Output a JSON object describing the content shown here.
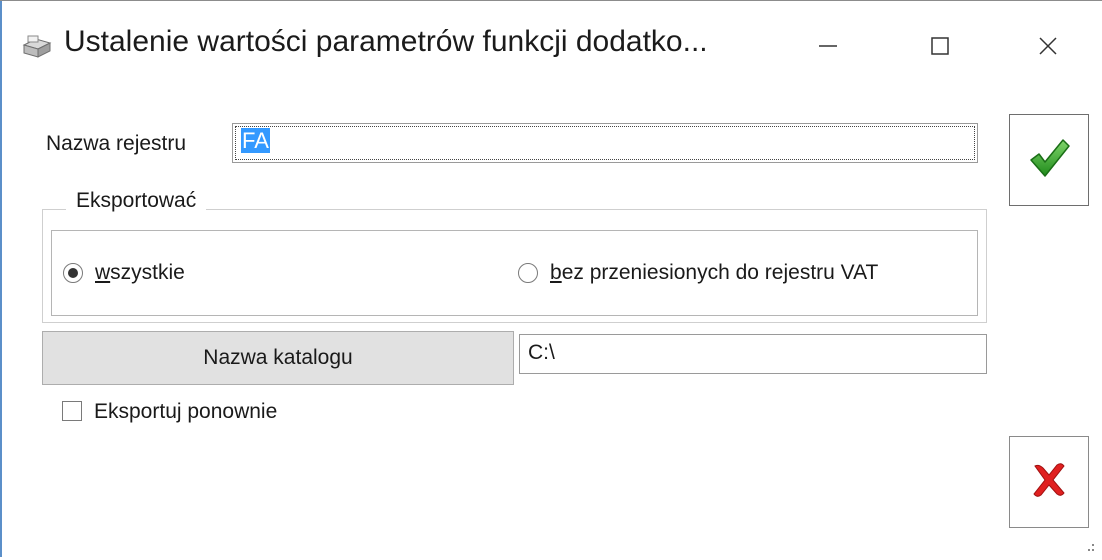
{
  "window": {
    "title": "Ustalenie wartości parametrów funkcji dodatko...",
    "minimize_glyph": "—",
    "maximize_glyph": "☐",
    "close_glyph": "✕"
  },
  "form": {
    "nazwa_rejestru_label": "Nazwa rejestru",
    "nazwa_rejestru_value": "FA",
    "eksportowac": {
      "title": "Eksportować",
      "options": [
        {
          "mnemonic": "w",
          "rest": "szystkie",
          "checked": true
        },
        {
          "mnemonic": "b",
          "rest": "ez przeniesionych do rejestru VAT",
          "checked": false
        }
      ]
    },
    "nazwa_katalogu_button": "Nazwa katalogu",
    "nazwa_katalogu_value": "C:\\",
    "eksportuj_ponownie_label": "Eksportuj ponownie",
    "eksportuj_ponownie_checked": false
  },
  "buttons": {
    "ok_icon": "green-checkmark-icon",
    "cancel_icon": "red-x-icon"
  },
  "colors": {
    "selection": "#3399ff",
    "ok_green": "#2e9e24",
    "cancel_red": "#e02020"
  }
}
